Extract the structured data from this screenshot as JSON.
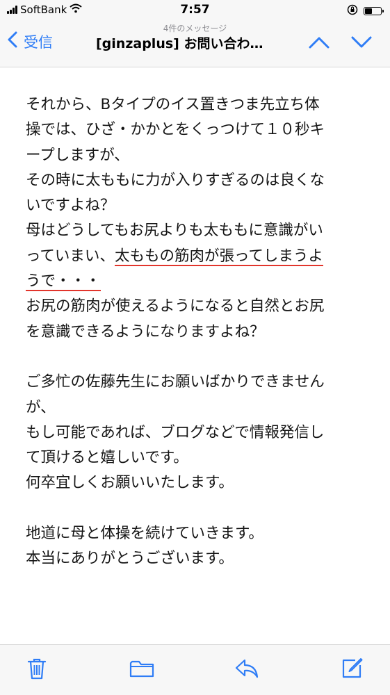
{
  "status": {
    "carrier": "SoftBank",
    "time": "7:57"
  },
  "nav": {
    "back_label": "受信",
    "subtitle": "4件のメッセージ",
    "title": "[ginzaplus] お問い合わ…"
  },
  "message": {
    "lines": [
      "それから、Bタイプのイス置きつま先立ち体",
      "操では、ひざ・かかとをくっつけて１０秒キ",
      "ープしますが、",
      "その時に太ももに力が入りすぎるのは良くな",
      "いですよね？",
      "母はどうしてもお尻よりも太ももに意識がい",
      "っていまい、",
      "太ももの筋肉が張ってしまうよ",
      "うで・・・",
      "お尻の筋肉が使えるようになると自然とお尻",
      "を意識できるようになりますよね？",
      "ご多忙の佐藤先生にお願いばかりできません",
      "が、",
      "もし可能であれば、ブログなどで情報発信し",
      "て頂けると嬉しいです。",
      "何卒宜しくお願いいたします。",
      "地道に母と体操を続けていきます。",
      "本当にありがとうございます。"
    ]
  },
  "colors": {
    "accent": "#2f7df6",
    "underline": "#e2352c"
  },
  "icons": {
    "back": "chevron-left-icon",
    "prev": "chevron-up-icon",
    "next": "chevron-down-icon",
    "trash": "trash-icon",
    "folder": "folder-icon",
    "reply": "reply-icon",
    "compose": "compose-icon"
  }
}
